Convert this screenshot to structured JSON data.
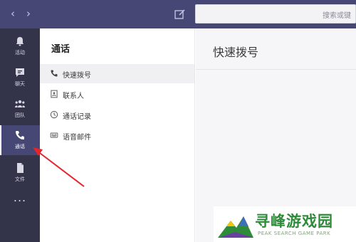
{
  "colors": {
    "topbar": "#464775",
    "rail": "#33344a",
    "arrow": "#e5242b",
    "watermark": "#2e8b3a"
  },
  "topbar": {
    "back_icon": "chevron-left-icon",
    "forward_icon": "chevron-right-icon",
    "compose_icon": "compose-icon",
    "search_placeholder": "搜索或键"
  },
  "rail": {
    "items": [
      {
        "label": "活动",
        "icon": "bell-icon"
      },
      {
        "label": "聊天",
        "icon": "chat-icon"
      },
      {
        "label": "团队",
        "icon": "teams-icon"
      },
      {
        "label": "通话",
        "icon": "phone-icon",
        "active": true
      },
      {
        "label": "文件",
        "icon": "file-icon"
      }
    ],
    "more": "..."
  },
  "panel": {
    "title": "通话",
    "items": [
      {
        "label": "快速拨号",
        "icon": "phone-icon",
        "active": true
      },
      {
        "label": "联系人",
        "icon": "contacts-icon"
      },
      {
        "label": "通话记录",
        "icon": "history-icon"
      },
      {
        "label": "语音邮件",
        "icon": "voicemail-icon"
      }
    ]
  },
  "main": {
    "title": "快速拨号"
  },
  "watermark": {
    "text": "寻峰游戏园",
    "sub": "PEAK SEARCH GAME PARK"
  }
}
